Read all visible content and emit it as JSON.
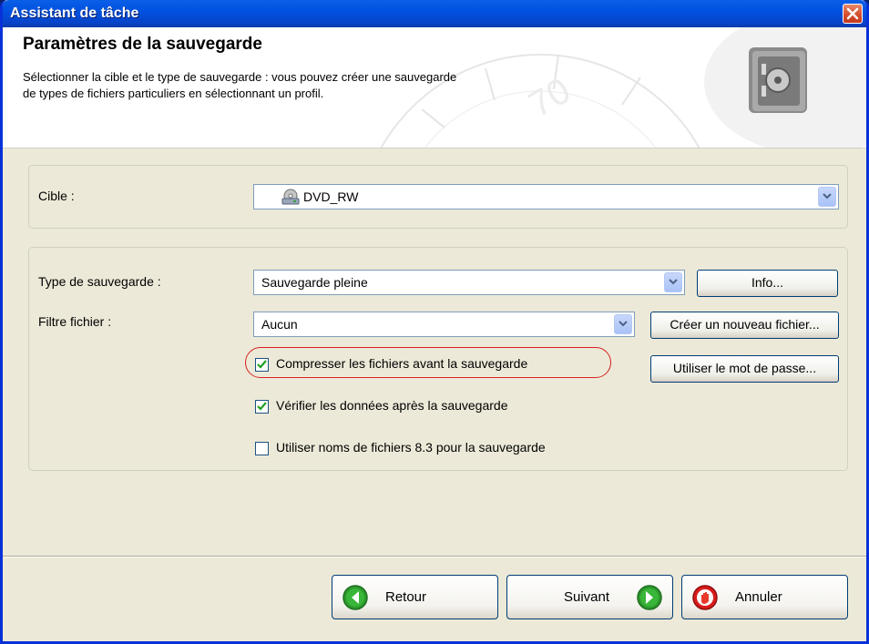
{
  "window": {
    "title": "Assistant de tâche"
  },
  "header": {
    "title": "Paramètres de la sauvegarde",
    "description_line1": "Sélectionner la cible et le type de sauvegarde : vous pouvez créer une sauvegarde",
    "description_line2": "de types de fichiers particuliers en sélectionnant un profil."
  },
  "target": {
    "label": "Cible :",
    "value": "DVD_RW",
    "icon": "cd-drive-icon"
  },
  "backup": {
    "type_label": "Type de sauvegarde :",
    "type_value": "Sauvegarde pleine",
    "info_button": "Info...",
    "filter_label": "Filtre fichier :",
    "filter_value": "Aucun",
    "new_file_button": "Créer un nouveau fichier...",
    "password_button": "Utiliser le mot de passe...",
    "options": [
      {
        "label": "Compresser les fichiers avant la sauvegarde",
        "checked": true
      },
      {
        "label": "Vérifier les données après la sauvegarde",
        "checked": true
      },
      {
        "label": "Utiliser noms de fichiers 8.3 pour la sauvegarde",
        "checked": false
      }
    ]
  },
  "nav": {
    "back": "Retour",
    "next": "Suivant",
    "cancel": "Annuler"
  },
  "colors": {
    "title_bar": "#0052e0",
    "close_red": "#d34a2a",
    "face": "#ece9d8",
    "green_icon": "#2c9a2c",
    "red_icon": "#d81c1c",
    "highlight_oval": "#d82020"
  }
}
